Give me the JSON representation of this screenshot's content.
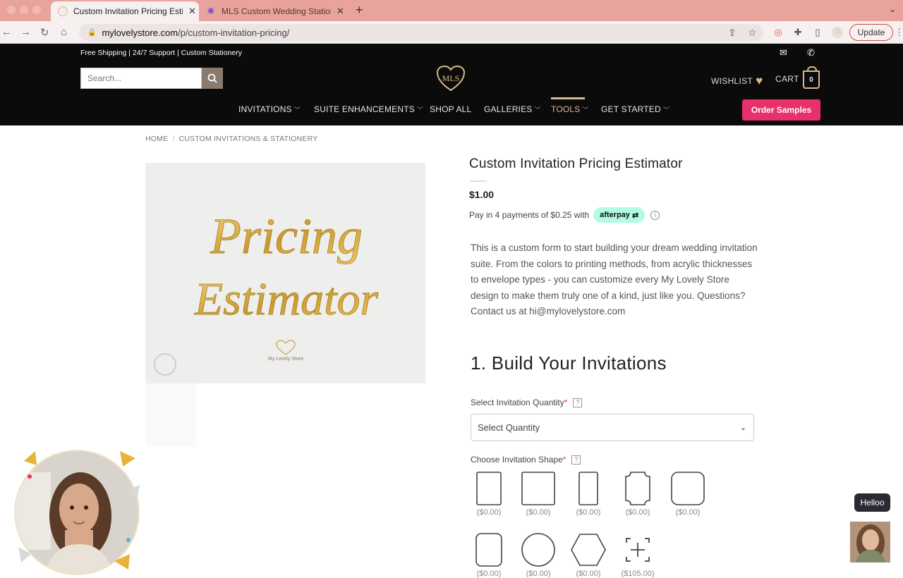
{
  "browser": {
    "tabs": [
      {
        "title": "Custom Invitation Pricing Estim",
        "active": true
      },
      {
        "title": "MLS Custom Wedding Statione",
        "active": false
      }
    ],
    "url_host": "mylovelystore.com",
    "url_path": "/p/custom-invitation-pricing/",
    "update_label": "Update"
  },
  "site": {
    "promo": "Free Shipping | 24/7 Support | Custom Stationery",
    "search_placeholder": "Search...",
    "logo_text": "MLS",
    "wishlist_label": "WISHLIST",
    "cart_label": "CART",
    "cart_count": "0",
    "nav": [
      {
        "label": "INVITATIONS",
        "caret": true,
        "active": false
      },
      {
        "label": "SUITE ENHANCEMENTS",
        "caret": true,
        "active": false
      },
      {
        "label": "SHOP ALL",
        "caret": false,
        "active": false
      },
      {
        "label": "GALLERIES",
        "caret": true,
        "active": false
      },
      {
        "label": "TOOLS",
        "caret": true,
        "active": true
      },
      {
        "label": "GET STARTED",
        "caret": true,
        "active": false
      }
    ],
    "order_samples": "Order Samples",
    "accent": "#e8306b",
    "gold": "#d9b98a"
  },
  "breadcrumb": [
    "HOME",
    "CUSTOM INVITATIONS & STATIONERY"
  ],
  "product": {
    "image_text_line1": "Pricing",
    "image_text_line2": "Estimator",
    "image_brand": "My Lovely Store",
    "title": "Custom Invitation Pricing Estimator",
    "price": "$1.00",
    "afterpay_text": "Pay in 4 payments of $0.25 with",
    "afterpay_badge": "afterpay",
    "description": "This is a custom form to start building your dream wedding invitation suite. From the colors to printing methods, from acrylic thicknesses to envelope types - you can customize every My Lovely Store design to make them truly one of a kind, just like you. Questions? Contact us at hi@mylovelystore.com"
  },
  "form": {
    "section_title": "1. Build Your Invitations",
    "quantity_label": "Select Invitation Quantity",
    "quantity_value": "Select Quantity",
    "shape_label": "Choose Invitation Shape",
    "shapes": [
      {
        "shape": "portrait-rect",
        "price": "($0.00)"
      },
      {
        "shape": "square",
        "price": "($0.00)"
      },
      {
        "shape": "tall-rect",
        "price": "($0.00)"
      },
      {
        "shape": "scalloped",
        "price": "($0.00)"
      },
      {
        "shape": "rounded-square",
        "price": "($0.00)"
      },
      {
        "shape": "rounded-rect",
        "price": "($0.00)"
      },
      {
        "shape": "circle",
        "price": "($0.00)"
      },
      {
        "shape": "hexagon",
        "price": "($0.00)"
      },
      {
        "shape": "custom-add",
        "price": "($105.00)"
      }
    ]
  },
  "chat": {
    "greeting": "Helloo"
  }
}
